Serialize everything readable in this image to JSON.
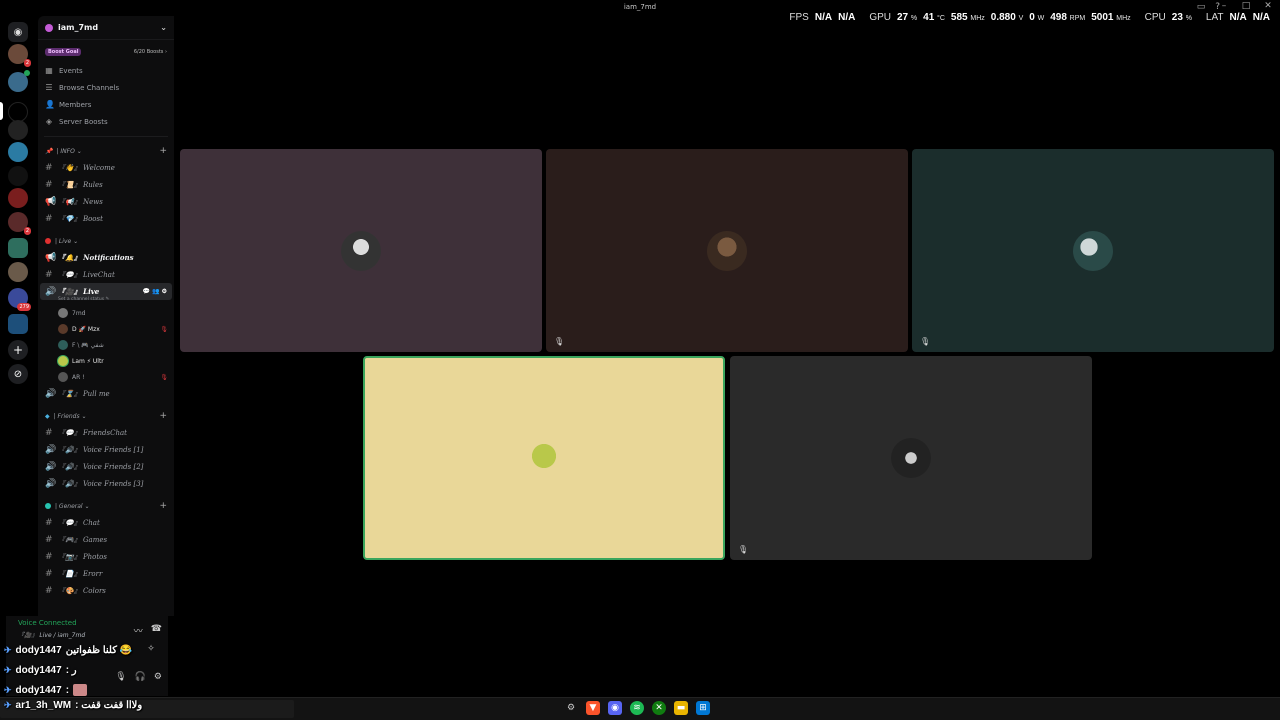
{
  "window": {
    "title": "iam_7md"
  },
  "overlay": {
    "fps_label": "FPS",
    "fps_a": "N/A",
    "fps_b": "N/A",
    "gpu_label": "GPU",
    "gpu_load": "27",
    "gpu_load_unit": "%",
    "gpu_temp": "41",
    "gpu_temp_unit": "°C",
    "gpu_clock": "585",
    "gpu_clock_unit": "MHz",
    "gpu_volt": "0.880",
    "gpu_volt_unit": "V",
    "gpu_power": "0",
    "gpu_power_unit": "W",
    "fan": "498",
    "fan_unit": "RPM",
    "mem_clock": "5001",
    "mem_clock_unit": "MHz",
    "cpu_label": "CPU",
    "cpu_load": "23",
    "cpu_load_unit": "%",
    "lat_label": "LAT",
    "lat_a": "N/A",
    "lat_b": "N/A"
  },
  "server": {
    "name": "iam_7md",
    "boost_goal": "Boost Goal",
    "boost_count": "6/20 Boosts ›"
  },
  "menu": [
    {
      "label": "Events",
      "icon": "calendar-icon"
    },
    {
      "label": "Browse Channels",
      "icon": "browse-icon"
    },
    {
      "label": "Members",
      "icon": "members-icon"
    },
    {
      "label": "Server Boosts",
      "icon": "boost-icon"
    }
  ],
  "categories": {
    "info": "| INFO ⌄",
    "live": "| Live ⌄",
    "friends": "| Friends ⌄",
    "general": "| General ⌄"
  },
  "channels": {
    "welcome": "『👋』 Welcome",
    "rules": "『📜』 Rules",
    "news": "『📢』 News",
    "boost": "『💎』 Boost",
    "notifications": "『🔔』 Notifications",
    "livechat": "『💬』 LiveChat",
    "live": "『🎥』 Live",
    "live_status": "Set a channel status ✎",
    "pullme": "『⌛』 Pull me",
    "friendschat": "『💬』 FriendsChat",
    "vf1": "『🔊』 Voice Friends [1]",
    "vf2": "『🔊』 Voice Friends [2]",
    "vf3": "『🔊』 Voice Friends [3]",
    "chat": "『💬』 Chat",
    "games": "『🎮』 Games",
    "photos": "『📷』 Photos",
    "erorr": "『📄』 Erorr",
    "colors": "『🎨』 Colors"
  },
  "voice_users": [
    {
      "name": "7md",
      "muted": false
    },
    {
      "name": "D 🚀 Mzx",
      "muted": true
    },
    {
      "name": "F \\ 🎮 شفي",
      "muted": false
    },
    {
      "name": "Lam ⚡ Ultr",
      "muted": false
    },
    {
      "name": "AR !",
      "muted": true
    }
  ],
  "voice_panel": {
    "status": "Voice Connected",
    "channel": "『🎥』 Live / iam_7md"
  },
  "chat_overlay": [
    {
      "user": "dody1447",
      "message": "كلنا ظفواتين 😂"
    },
    {
      "user": "dody1447",
      "message": ": ر"
    },
    {
      "user": "dody1447",
      "message": ":"
    },
    {
      "user": "ar1_3h_WM",
      "message": ": ولااا قفت قفت"
    }
  ],
  "colors": {
    "tile1": "#3e3039",
    "tile2": "#2a1d1b",
    "tile3": "#1b2d2c",
    "tile4": "#e9d798",
    "tile5": "#2a2a2a",
    "speaking": "#3ba55d"
  }
}
